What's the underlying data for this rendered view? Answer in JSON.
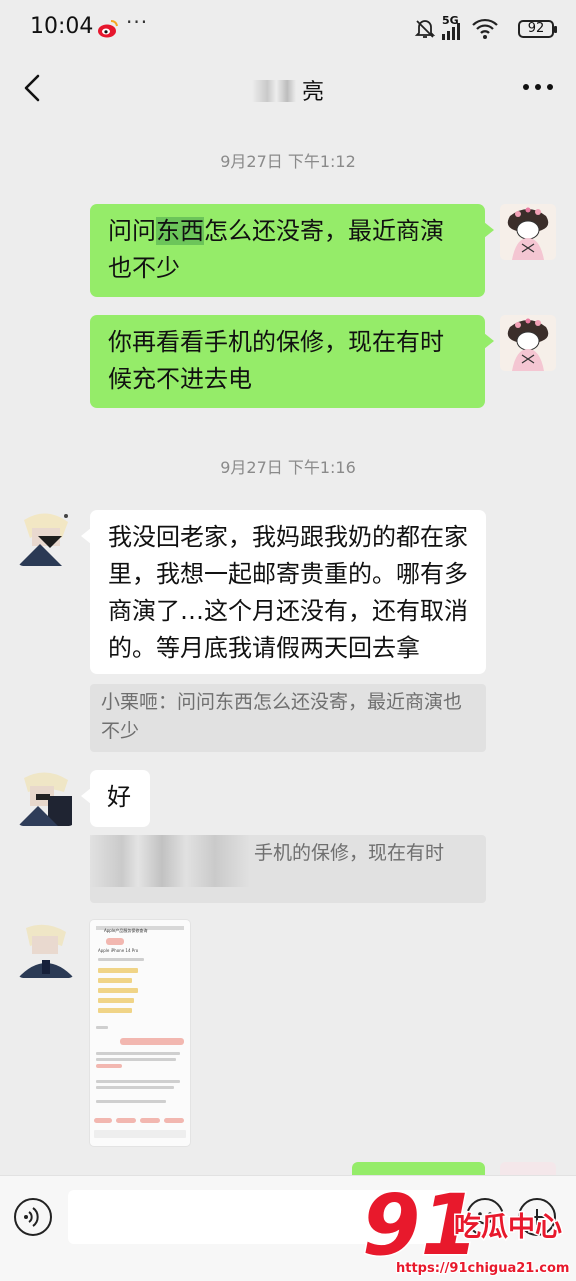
{
  "status_bar": {
    "time": "10:04",
    "more": "···",
    "network": "5G",
    "battery": "92"
  },
  "nav": {
    "title": "亮"
  },
  "messages": {
    "ts1": "9月27日 下午1:12",
    "out1_pre": "问问",
    "out1_hl": "东西",
    "out1_post": "怎么还没寄，最近商演也不少",
    "out2": "你再看看手机的保修，现在有时候充不进去电",
    "ts2": "9月27日 下午1:16",
    "in1": "我没回老家，我妈跟我奶的都在家里，我想一起邮寄贵重的。哪有多商演了…这个月还没有，还有取消的。等月底我请假两天回去拿",
    "quote1": "小栗咂：问问东西怎么还没寄，最近商演也不少",
    "in2": "好",
    "quote2": "手机的保修，现在有时"
  },
  "screenshot_msg": {
    "title": "Apple产品服务保修查询",
    "subtitle": "Apple iPhone 14 Pro"
  },
  "input_bar": {
    "placeholder": ""
  },
  "watermark": {
    "number": "91",
    "brand": "吃瓜中心",
    "url": "https://91chigua21.com"
  },
  "colors": {
    "outgoing_bubble": "#95ec69",
    "incoming_bubble": "#ffffff",
    "background": "#ededed",
    "watermark_red": "#e8192c"
  },
  "icons": [
    "back-arrow-icon",
    "more-menu-icon",
    "voice-icon",
    "emoji-icon",
    "plus-icon",
    "mute-bell-icon",
    "signal-icon",
    "wifi-icon",
    "battery-icon",
    "weibo-app-icon"
  ]
}
